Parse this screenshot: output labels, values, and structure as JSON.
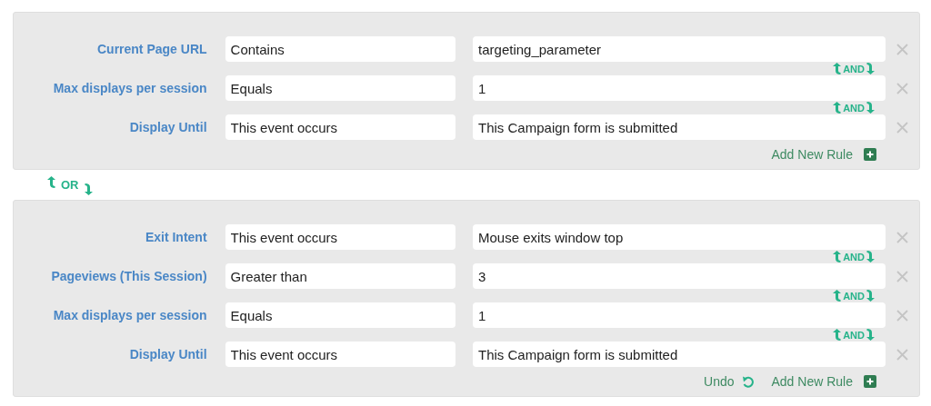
{
  "groups": [
    {
      "rules": [
        {
          "label": "Current Page URL",
          "operator": "Contains",
          "value": "targeting_parameter"
        },
        {
          "connector": "AND",
          "label": "Max displays per session",
          "operator": "Equals",
          "value": "1"
        },
        {
          "connector": "AND",
          "label": "Display Until",
          "operator": "This event occurs",
          "value": "This Campaign form is submitted"
        }
      ],
      "actions": [
        {
          "kind": "add",
          "label": "Add New Rule"
        }
      ]
    },
    {
      "separator": "OR",
      "rules": [
        {
          "label": "Exit Intent",
          "operator": "This event occurs",
          "value": "Mouse exits window top"
        },
        {
          "connector": "AND",
          "label": "Pageviews (This Session)",
          "operator": "Greater than",
          "value": "3"
        },
        {
          "connector": "AND",
          "label": "Max displays per session",
          "operator": "Equals",
          "value": "1"
        },
        {
          "connector": "AND",
          "label": "Display Until",
          "operator": "This event occurs",
          "value": "This Campaign form is submitted"
        }
      ],
      "actions": [
        {
          "kind": "undo",
          "label": "Undo"
        },
        {
          "kind": "add",
          "label": "Add New Rule"
        }
      ]
    }
  ]
}
